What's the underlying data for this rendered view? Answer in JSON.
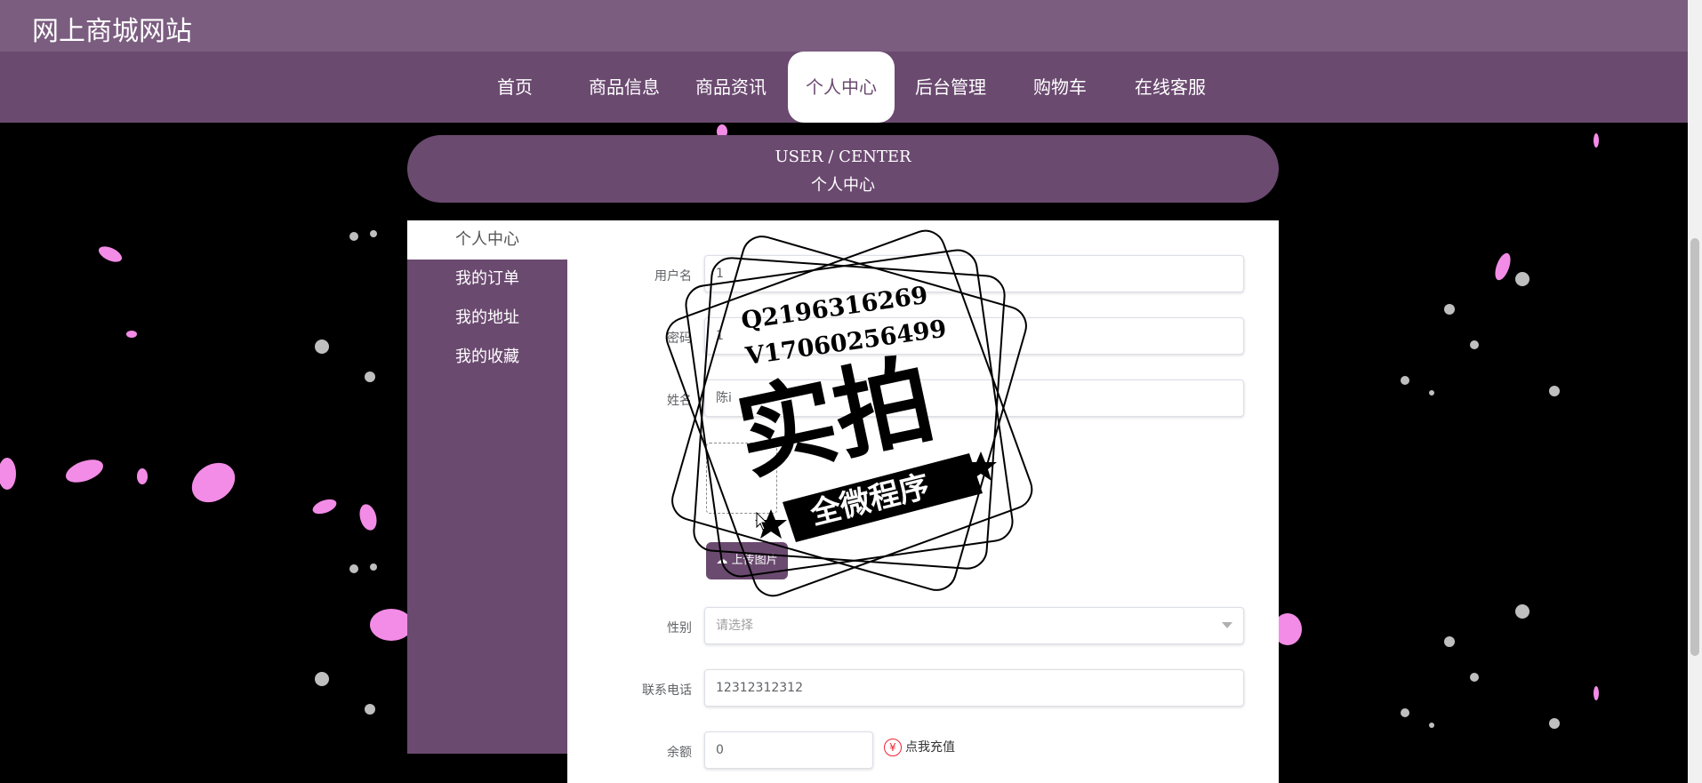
{
  "header": {
    "site_title": "网上商城网站"
  },
  "nav": {
    "items": [
      {
        "label": "首页"
      },
      {
        "label": "商品信息"
      },
      {
        "label": "商品资讯"
      },
      {
        "label": "个人中心",
        "active": true
      },
      {
        "label": "后台管理"
      },
      {
        "label": "购物车"
      },
      {
        "label": "在线客服"
      }
    ]
  },
  "banner": {
    "en": "USER / CENTER",
    "zh": "个人中心"
  },
  "sidebar": {
    "items": [
      {
        "label": "个人中心",
        "active": true
      },
      {
        "label": "我的订单"
      },
      {
        "label": "我的地址"
      },
      {
        "label": "我的收藏"
      }
    ]
  },
  "form": {
    "username": {
      "label": "用户名",
      "value": "1"
    },
    "password": {
      "label": "密码",
      "value": "1"
    },
    "name": {
      "label": "姓名",
      "value": "陈i"
    },
    "upload_label": "上传图片",
    "gender": {
      "label": "性别",
      "placeholder": "请选择"
    },
    "phone": {
      "label": "联系电话",
      "value": "12312312312"
    },
    "balance": {
      "label": "余额",
      "value": "0"
    },
    "recharge_label": "点我充值",
    "yen_symbol": "¥"
  },
  "watermark": {
    "line1": "Q2196316269",
    "line2": "V17060256499",
    "main": "实拍",
    "ribbon": "全微程序"
  },
  "colors": {
    "primary": "#6b4a70",
    "title_bar": "#7b5d80",
    "petal": "#f59ae8"
  }
}
